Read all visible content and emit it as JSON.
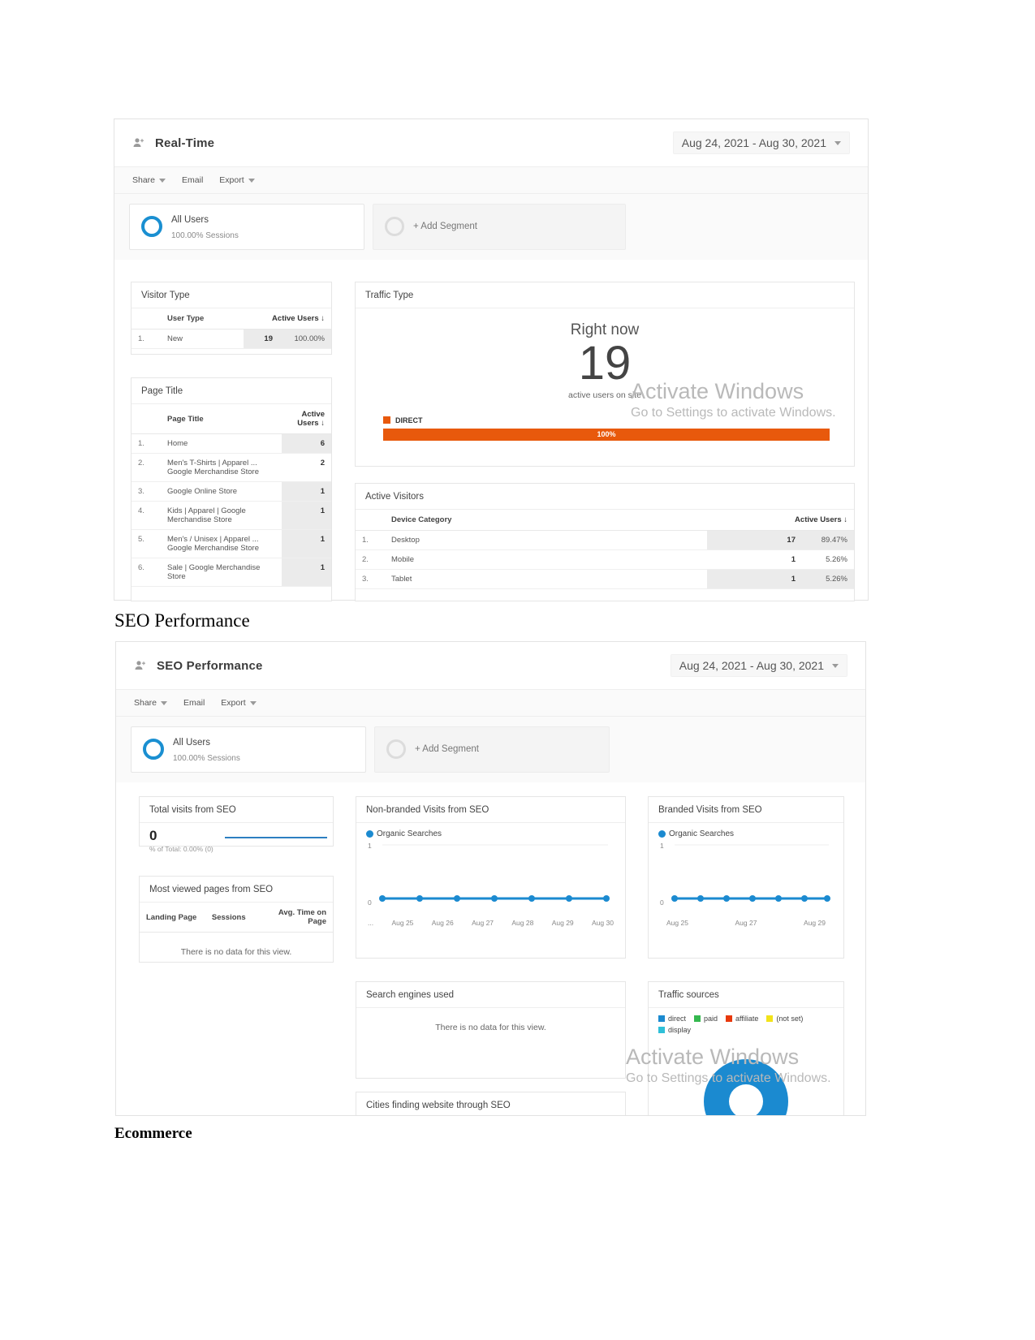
{
  "document": {
    "heading_seo": "SEO Performance",
    "heading_ecommerce": "Ecommerce"
  },
  "watermark": {
    "line1": "Activate Windows",
    "line2": "Go to Settings to activate Windows."
  },
  "realtime_report": {
    "icon": "add-person-icon",
    "title": "Real-Time",
    "date_range": "Aug 24, 2021 - Aug 30, 2021",
    "toolbar": {
      "share": "Share",
      "email": "Email",
      "export": "Export"
    },
    "segments": {
      "all_users_name": "All Users",
      "all_users_sub": "100.00% Sessions",
      "add_segment": "+ Add Segment"
    },
    "visitor_type": {
      "title": "Visitor Type",
      "columns": [
        "User Type",
        "Active Users"
      ],
      "rows": [
        {
          "index": "1.",
          "user_type": "New",
          "active_users": "19",
          "percent": "100.00%"
        }
      ]
    },
    "page_title": {
      "title": "Page Title",
      "columns": [
        "Page Title",
        "Active Users"
      ],
      "rows": [
        {
          "index": "1.",
          "page": "Home",
          "active_users": "6"
        },
        {
          "index": "2.",
          "page": "Men's T-Shirts | Apparel ... Google Merchandise Store",
          "active_users": "2"
        },
        {
          "index": "3.",
          "page": "Google Online Store",
          "active_users": "1"
        },
        {
          "index": "4.",
          "page": "Kids | Apparel | Google Merchandise Store",
          "active_users": "1"
        },
        {
          "index": "5.",
          "page": "Men's / Unisex | Apparel ... Google Merchandise Store",
          "active_users": "1"
        },
        {
          "index": "6.",
          "page": "Sale | Google Merchandise Store",
          "active_users": "1"
        }
      ]
    },
    "traffic_type": {
      "title": "Traffic Type",
      "right_now_label": "Right now",
      "active_users": "19",
      "active_users_sub": "active users on site",
      "legend_label": "DIRECT",
      "bar_label": "100%",
      "bar_color": "#e8590c"
    },
    "active_visitors": {
      "title": "Active Visitors",
      "columns": [
        "Device Category",
        "Active Users"
      ],
      "rows": [
        {
          "index": "1.",
          "device": "Desktop",
          "active_users": "17",
          "percent": "89.47%"
        },
        {
          "index": "2.",
          "device": "Mobile",
          "active_users": "1",
          "percent": "5.26%"
        },
        {
          "index": "3.",
          "device": "Tablet",
          "active_users": "1",
          "percent": "5.26%"
        }
      ]
    }
  },
  "seo_report": {
    "icon": "add-person-icon",
    "title": "SEO Performance",
    "date_range": "Aug 24, 2021 - Aug 30, 2021",
    "toolbar": {
      "share": "Share",
      "email": "Email",
      "export": "Export"
    },
    "segments": {
      "all_users_name": "All Users",
      "all_users_sub": "100.00% Sessions",
      "add_segment": "+ Add Segment"
    },
    "total_visits": {
      "title": "Total visits from SEO",
      "value": "0",
      "subtext": "% of Total: 0.00% (0)"
    },
    "most_viewed_pages": {
      "title": "Most viewed pages from SEO",
      "columns": [
        "Landing Page",
        "Sessions",
        "Avg. Time on Page"
      ],
      "empty_message": "There is no data for this view."
    },
    "non_branded": {
      "title": "Non-branded Visits from SEO",
      "legend": "Organic Searches"
    },
    "branded": {
      "title": "Branded Visits from SEO",
      "legend": "Organic Searches"
    },
    "search_engines": {
      "title": "Search engines used",
      "empty_message": "There is no data for this view."
    },
    "traffic_sources": {
      "title": "Traffic sources",
      "legend": [
        {
          "label": "direct",
          "color": "#1b8ad0"
        },
        {
          "label": "paid",
          "color": "#35b84f"
        },
        {
          "label": "affiliate",
          "color": "#e8390c"
        },
        {
          "label": "(not set)",
          "color": "#f2e31a"
        },
        {
          "label": "display",
          "color": "#2fc0d8"
        }
      ]
    },
    "cities": {
      "title": "Cities finding website through SEO"
    }
  },
  "chart_data": [
    {
      "type": "line",
      "title": "Non-branded Visits from SEO",
      "series": [
        {
          "name": "Organic Searches",
          "values": [
            0,
            0,
            0,
            0,
            0,
            0,
            0
          ]
        }
      ],
      "categories": [
        "...",
        "Aug 25",
        "Aug 26",
        "Aug 27",
        "Aug 28",
        "Aug 29",
        "Aug 30"
      ],
      "xlabel": "",
      "ylabel": "",
      "ylim": [
        0,
        1
      ],
      "ytick_labels": [
        "1",
        "0"
      ],
      "grid": false,
      "legend_position": "top-left",
      "color": "#1b8ad0"
    },
    {
      "type": "line",
      "title": "Branded Visits from SEO",
      "series": [
        {
          "name": "Organic Searches",
          "values": [
            0,
            0,
            0,
            0,
            0,
            0,
            0
          ]
        }
      ],
      "categories": [
        "Aug 25",
        "Aug 27",
        "Aug 29"
      ],
      "xlabel": "",
      "ylabel": "",
      "ylim": [
        0,
        1
      ],
      "ytick_labels": [
        "1",
        "0"
      ],
      "grid": false,
      "legend_position": "top-left",
      "color": "#1b8ad0"
    },
    {
      "type": "bar",
      "title": "Traffic Type",
      "categories": [
        "DIRECT"
      ],
      "values": [
        100
      ],
      "xlabel": "",
      "ylabel": "",
      "ylim": [
        0,
        100
      ],
      "data_labels": [
        "100%"
      ],
      "color": "#e8590c"
    },
    {
      "type": "pie",
      "title": "Traffic sources",
      "labels": [
        "direct",
        "paid",
        "affiliate",
        "(not set)",
        "display"
      ],
      "values": [
        100,
        0,
        0,
        0,
        0
      ],
      "colors": [
        "#1b8ad0",
        "#35b84f",
        "#e8390c",
        "#f2e31a",
        "#2fc0d8"
      ],
      "legend_position": "top"
    }
  ]
}
